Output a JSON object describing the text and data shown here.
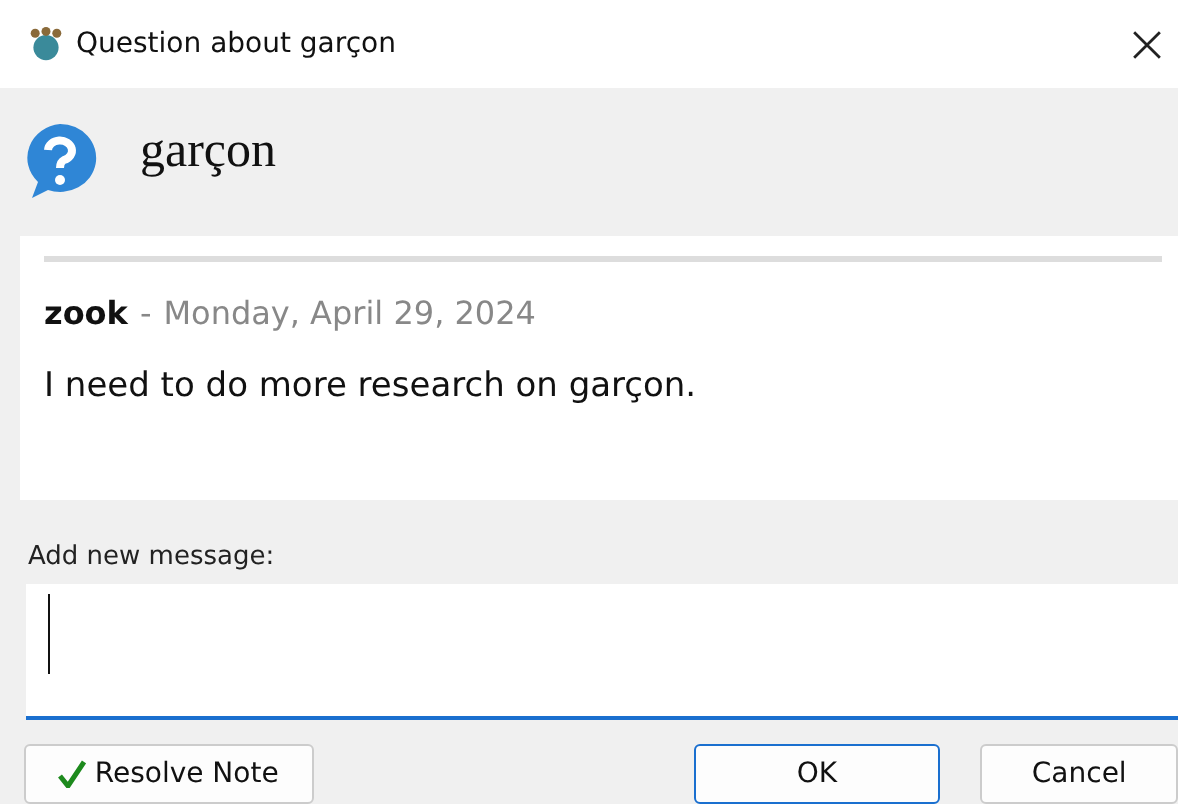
{
  "window": {
    "title": "Question about garçon"
  },
  "header": {
    "word": "garçon"
  },
  "messages": [
    {
      "author": "zook",
      "separator": "-",
      "date": "Monday, April 29, 2024",
      "text": "I need to do more research on garçon."
    }
  ],
  "new_message": {
    "label": "Add new message:"
  },
  "buttons": [
    {
      "kind": "resolve",
      "label": "Resolve Note"
    },
    {
      "kind": "default",
      "label": "OK"
    },
    {
      "kind": "plain",
      "label": "Cancel"
    }
  ]
}
